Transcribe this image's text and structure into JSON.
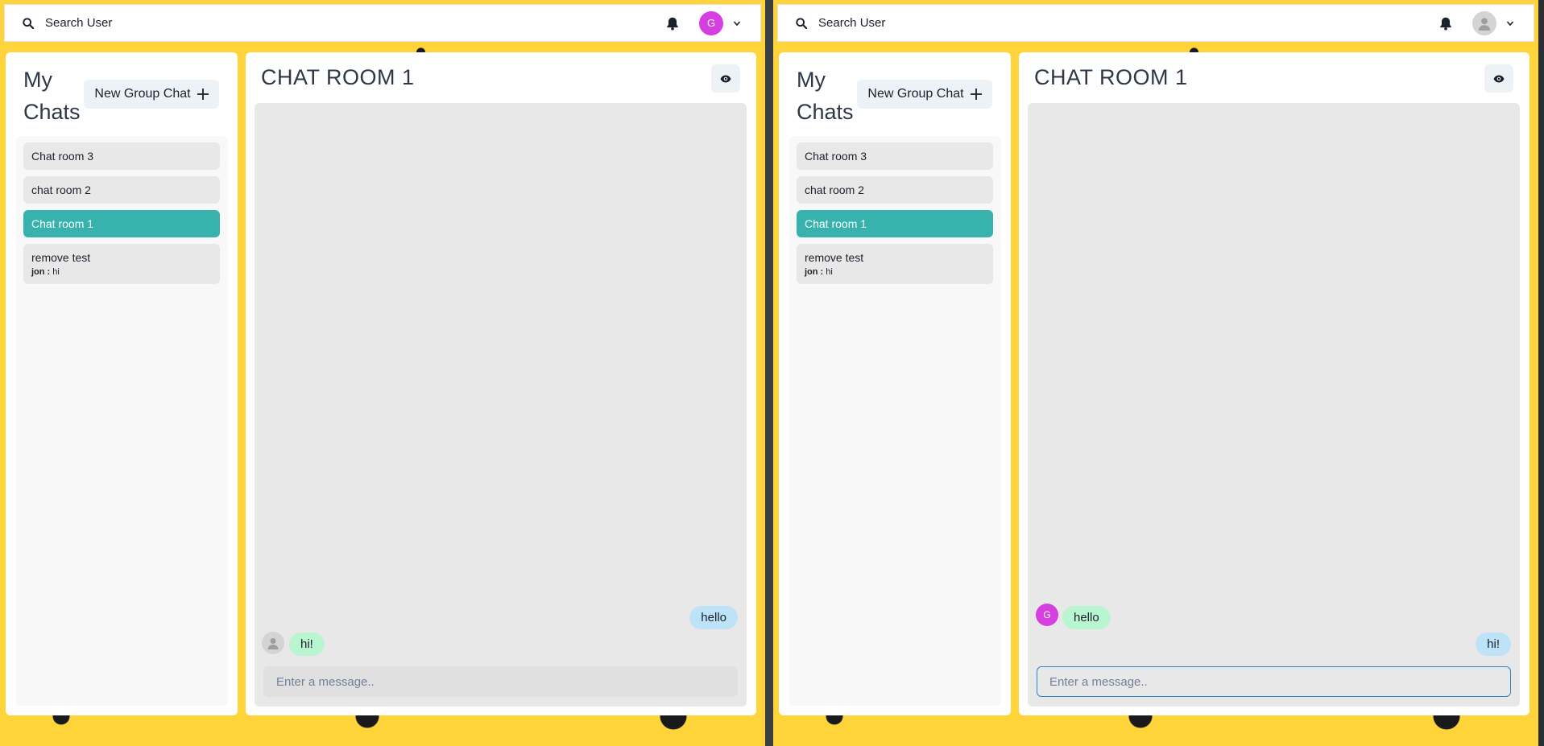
{
  "colors": {
    "background": "#FFD43B",
    "active_chat": "#38B2AC",
    "avatar_g": "#D53FE0",
    "bubble_blue": "#BEE3F8",
    "bubble_green": "#B9F5D0"
  },
  "left_window": {
    "search_label": "Search User",
    "avatar_letter": "G",
    "my_chats_title": "My Chats",
    "new_group_label": "New Group Chat",
    "chats": [
      {
        "name": "Chat room 3"
      },
      {
        "name": "chat room 2"
      },
      {
        "name": "Chat room 1",
        "active": true
      },
      {
        "name": "remove test",
        "preview_sender": "jon :",
        "preview_text": "hi"
      }
    ],
    "room_title": "CHAT ROOM 1",
    "messages": [
      {
        "text": "hello",
        "side": "right"
      },
      {
        "text": "hi!",
        "side": "left"
      }
    ],
    "input_placeholder": "Enter a message.."
  },
  "right_window": {
    "search_label": "Search User",
    "my_chats_title": "My Chats",
    "new_group_label": "New Group Chat",
    "chats": [
      {
        "name": "Chat room 3"
      },
      {
        "name": "chat room 2"
      },
      {
        "name": "Chat room 1",
        "active": true
      },
      {
        "name": "remove test",
        "preview_sender": "jon :",
        "preview_text": "hi"
      }
    ],
    "room_title": "CHAT ROOM 1",
    "messages": [
      {
        "text": "hello",
        "side": "left",
        "avatar_letter": "G"
      },
      {
        "text": "hi!",
        "side": "right"
      }
    ],
    "input_placeholder": "Enter a message.."
  }
}
